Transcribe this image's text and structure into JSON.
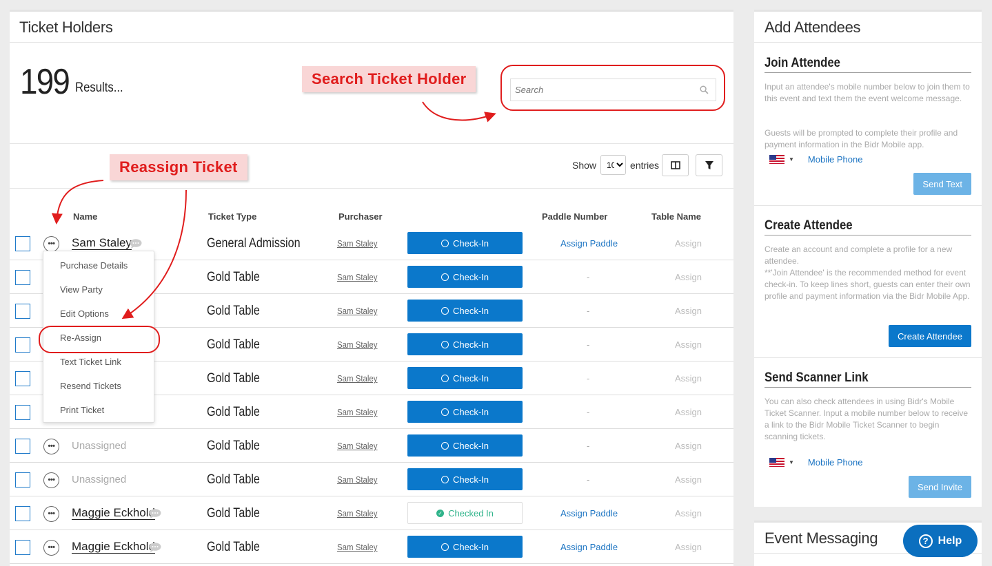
{
  "ticket_holders": {
    "title": "Ticket Holders",
    "results_count": "199",
    "results_label": "Results...",
    "search_placeholder": "Search",
    "show_label": "Show",
    "entries_value": "10",
    "entries_label": "entries",
    "columns": {
      "name": "Name",
      "ticket_type": "Ticket Type",
      "purchaser": "Purchaser",
      "paddle_number": "Paddle Number",
      "table_name": "Table Name"
    },
    "rows": [
      {
        "name": "Sam Staley",
        "ticket_type": "General Admission",
        "purchaser": "Sam Staley",
        "status": "Check-In",
        "paddle": "Assign Paddle",
        "table": "Assign"
      },
      {
        "name": "",
        "ticket_type": "Gold Table",
        "purchaser": "Sam Staley",
        "status": "Check-In",
        "paddle": "-",
        "table": "Assign"
      },
      {
        "name": "",
        "ticket_type": "Gold Table",
        "purchaser": "Sam Staley",
        "status": "Check-In",
        "paddle": "-",
        "table": "Assign"
      },
      {
        "name": "",
        "ticket_type": "Gold Table",
        "purchaser": "Sam Staley",
        "status": "Check-In",
        "paddle": "-",
        "table": "Assign"
      },
      {
        "name": "",
        "ticket_type": "Gold Table",
        "purchaser": "Sam Staley",
        "status": "Check-In",
        "paddle": "-",
        "table": "Assign"
      },
      {
        "name": "",
        "ticket_type": "Gold Table",
        "purchaser": "Sam Staley",
        "status": "Check-In",
        "paddle": "-",
        "table": "Assign"
      },
      {
        "name": "Unassigned",
        "ticket_type": "Gold Table",
        "purchaser": "Sam Staley",
        "status": "Check-In",
        "paddle": "-",
        "table": "Assign"
      },
      {
        "name": "Unassigned",
        "ticket_type": "Gold Table",
        "purchaser": "Sam Staley",
        "status": "Check-In",
        "paddle": "-",
        "table": "Assign"
      },
      {
        "name": "Maggie Eckhold",
        "ticket_type": "Gold Table",
        "purchaser": "Sam Staley",
        "status": "Checked In",
        "paddle": "Assign Paddle",
        "table": "Assign"
      },
      {
        "name": "Maggie Eckhold",
        "ticket_type": "Gold Table",
        "purchaser": "Sam Staley",
        "status": "Check-In",
        "paddle": "Assign Paddle",
        "table": "Assign"
      }
    ]
  },
  "row_menu": {
    "items": [
      "Purchase Details",
      "View Party",
      "Edit Options",
      "Re-Assign",
      "Text Ticket Link",
      "Resend Tickets",
      "Print Ticket"
    ]
  },
  "add_attendees": {
    "title": "Add Attendees",
    "join": {
      "heading": "Join Attendee",
      "text": "Input an attendee's mobile number below to join them to this event and text them the event welcome message.",
      "text2": "Guests will be prompted to complete their profile and payment information in the Bidr Mobile app.",
      "phone_label": "Mobile Phone",
      "button": "Send Text"
    },
    "create": {
      "heading": "Create Attendee",
      "text": "Create an account and complete a profile for a new attendee.",
      "text2": "**'Join Attendee' is the recommended method for event check-in. To keep lines short, guests can enter their own profile and payment information via the Bidr Mobile App.",
      "button": "Create Attendee"
    },
    "scanner": {
      "heading": "Send Scanner Link",
      "text": "You can also check attendees in using Bidr's Mobile Ticket Scanner. Input a mobile number below to receive a link to the Bidr Mobile Ticket Scanner to begin scanning tickets.",
      "phone_label": "Mobile Phone",
      "button": "Send Invite"
    }
  },
  "event_messaging": {
    "title": "Event Messaging"
  },
  "help": {
    "label": "Help"
  },
  "annotations": {
    "search_callout": "Search Ticket Holder",
    "reassign_callout": "Reassign Ticket",
    "color": "#e01d1d"
  },
  "colors": {
    "primary": "#0b78cb",
    "link": "#1a73c2",
    "checked_in": "#2fb38a"
  }
}
